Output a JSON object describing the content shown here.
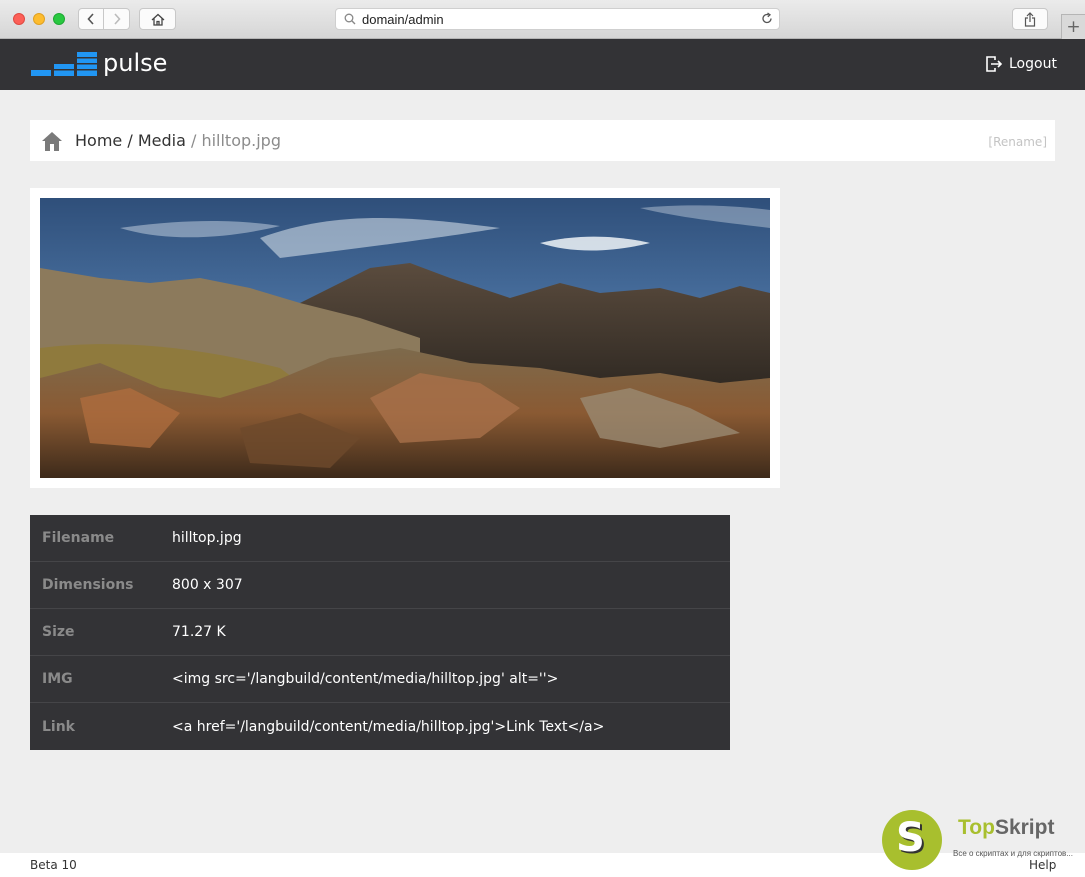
{
  "browser": {
    "url": "domain/admin"
  },
  "header": {
    "logo_text": "pulse",
    "logout_label": "Logout"
  },
  "breadcrumb": {
    "home": "Home",
    "sep1": " / ",
    "media": "Media",
    "sep2": " / ",
    "current": "hilltop.jpg",
    "rename_label": "[Rename]"
  },
  "image": {
    "description": "mountain landscape photo"
  },
  "info": {
    "rows": [
      {
        "label": "Filename",
        "value": "hilltop.jpg"
      },
      {
        "label": "Dimensions",
        "value": "800 x 307"
      },
      {
        "label": "Size",
        "value": "71.27 K"
      },
      {
        "label": "IMG",
        "value": "<img src='/langbuild/content/media/hilltop.jpg' alt=''>"
      },
      {
        "label": "Link",
        "value": "<a href='/langbuild/content/media/hilltop.jpg'>Link Text</a>"
      }
    ]
  },
  "footer": {
    "version": "Beta 10",
    "help": "Help"
  },
  "watermark": {
    "letter": "S",
    "brand_a": "Top",
    "brand_b": "Skript",
    "tagline": "Все о скриптах и для скриптов..."
  },
  "colors": {
    "accent": "#2196f3",
    "header_bg": "#333336",
    "page_bg": "#eeeeee"
  }
}
